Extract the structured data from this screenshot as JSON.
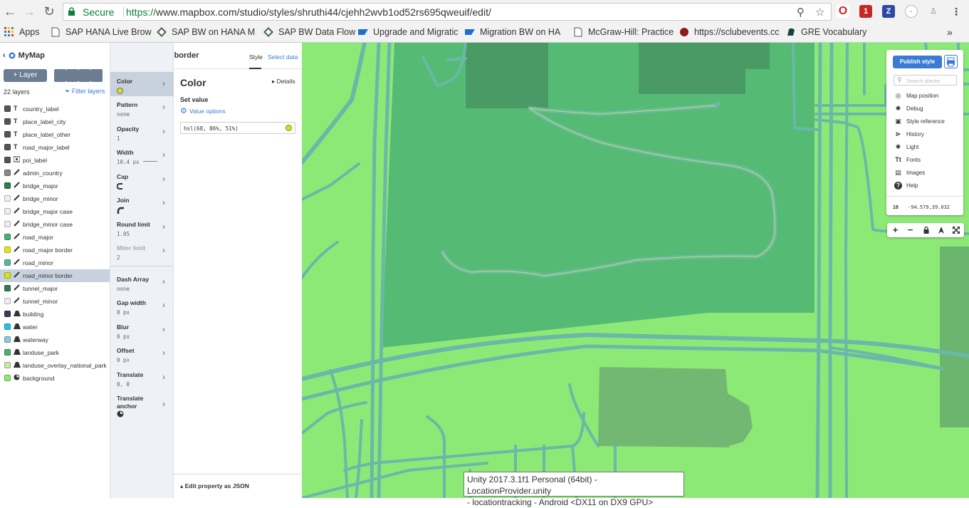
{
  "browser": {
    "secure_label": "Secure",
    "url_proto": "https://",
    "url_rest": "www.mapbox.com/studio/styles/shruthi44/cjehh2wvb1od52rs695qweuif/edit/",
    "ext_badge": "1",
    "bookmarks": [
      "Apps",
      "SAP HANA Live Brow",
      "SAP BW on HANA M",
      "SAP BW Data Flow",
      "Upgrade and Migratic",
      "Migration BW on HA",
      "McGraw-Hill: Practice",
      "https://sclubevents.cc",
      "GRE Vocabulary"
    ],
    "overflow": "»"
  },
  "app": {
    "back_label": "MyMap",
    "add_layer": "Layer",
    "layer_count": "22 layers",
    "filter_layers": "Filter layers",
    "layers": [
      {
        "name": "country_label",
        "color": "#555555",
        "type": "T"
      },
      {
        "name": "place_label_city",
        "color": "#555555",
        "type": "T"
      },
      {
        "name": "place_label_other",
        "color": "#555555",
        "type": "T"
      },
      {
        "name": "road_major_label",
        "color": "#555555",
        "type": "T"
      },
      {
        "name": "poi_label",
        "color": "#555555",
        "type": "poi"
      },
      {
        "name": "admin_country",
        "color": "#888888",
        "type": "line"
      },
      {
        "name": "bridge_major",
        "color": "#2e7d4f",
        "type": "line"
      },
      {
        "name": "bridge_minor",
        "color": "#eeeeee",
        "type": "line"
      },
      {
        "name": "bridge_major case",
        "color": "#eeeeee",
        "type": "line"
      },
      {
        "name": "bridge_minor case",
        "color": "#eeeeee",
        "type": "line"
      },
      {
        "name": "road_major",
        "color": "#4caf7a",
        "type": "line"
      },
      {
        "name": "road_major border",
        "color": "#e3e619",
        "type": "line"
      },
      {
        "name": "road_minor",
        "color": "#5cb3a0",
        "type": "line"
      },
      {
        "name": "road_minor border",
        "color": "#d4e31f",
        "type": "line"
      },
      {
        "name": "tunnel_major",
        "color": "#2e7d4f",
        "type": "line"
      },
      {
        "name": "tunnel_minor",
        "color": "#eeeeee",
        "type": "line"
      },
      {
        "name": "building",
        "color": "#3a3a5a",
        "type": "fill"
      },
      {
        "name": "water",
        "color": "#24c2e6",
        "type": "fill"
      },
      {
        "name": "waterway",
        "color": "#8cc6e0",
        "type": "fill"
      },
      {
        "name": "landuse_park",
        "color": "#4caf6a",
        "type": "fill"
      },
      {
        "name": "landuse_overlay_national_park",
        "color": "#c6e8a8",
        "type": "fill"
      },
      {
        "name": "background",
        "color": "#8de976",
        "type": "bg"
      }
    ],
    "selected_layer": "road_minor border",
    "tab_style": "Style",
    "tab_data": "Select data",
    "properties": [
      {
        "name": "Color",
        "value": ""
      },
      {
        "name": "Pattern",
        "value": "none"
      },
      {
        "name": "Opacity",
        "value": "1"
      },
      {
        "name": "Width",
        "value": "10.4 px"
      },
      {
        "name": "Cap",
        "value": ""
      },
      {
        "name": "Join",
        "value": ""
      },
      {
        "name": "Round limit",
        "value": "1.05"
      },
      {
        "name": "Miter limit",
        "value": "2"
      },
      {
        "name": "Dash Array",
        "value": "none"
      },
      {
        "name": "Gap width",
        "value": "0 px"
      },
      {
        "name": "Blur",
        "value": "0 px"
      },
      {
        "name": "Offset",
        "value": "0 px"
      },
      {
        "name": "Translate",
        "value": "0, 0"
      },
      {
        "name": "Translate anchor",
        "value": ""
      }
    ],
    "detail": {
      "title": "Color",
      "details_link": "Details",
      "set_value": "Set value",
      "value_options": "Value options",
      "value": "hsl(68, 86%, 51%)",
      "swatch_color": "#d4e31f",
      "edit_json": "Edit property as JSON"
    }
  },
  "map_controls": {
    "publish": "Publish style",
    "search_placeholder": "Search places",
    "menu": [
      "Map position",
      "Debug",
      "Style reference",
      "History",
      "Light",
      "Fonts",
      "Images",
      "Help"
    ],
    "zoom": "18",
    "coords": "-94.579,39.032",
    "nav": [
      "+",
      "−",
      "▲",
      "◬",
      "⤢"
    ]
  },
  "tooltip": {
    "line1": "Unity 2017.3.1f1 Personal (64bit) - LocationProvider.unity",
    "line2": "- locationtracking - Android <DX11 on DX9 GPU>"
  },
  "colors": {
    "map_bg": "#8de976",
    "park": "#55bb74",
    "building": "#4a9a66",
    "road": "#6ab8a8",
    "accent": "#3b7bd4"
  }
}
